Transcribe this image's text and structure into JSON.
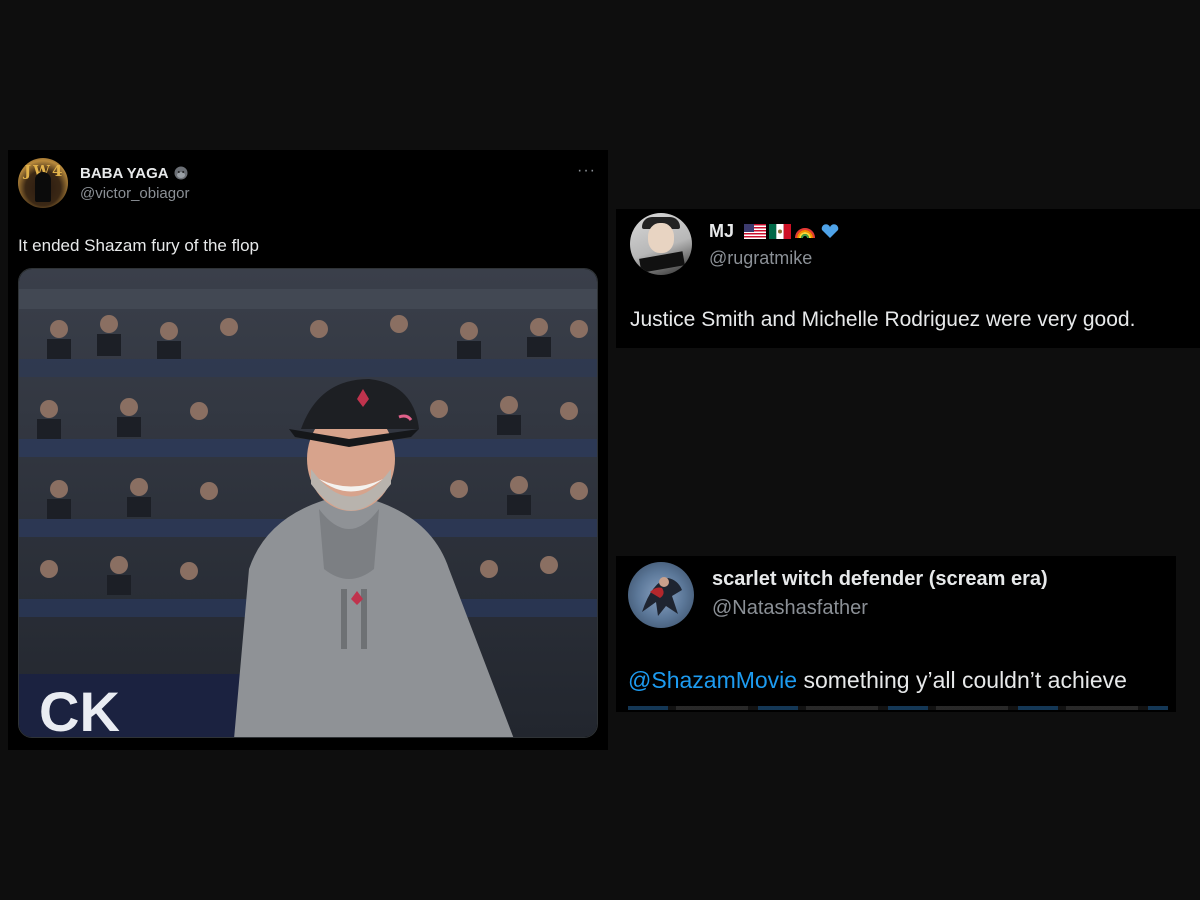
{
  "tweets": [
    {
      "display_name": "BABA YAGA",
      "badge_icon": "gorilla-emoji-icon",
      "handle": "@victor_obiagor",
      "more_label": "···",
      "text": "It ended Shazam fury of the flop",
      "media_description_icon": "photo-smiling-man-in-grey-hoodie-and-cap-stadium-crowd"
    },
    {
      "display_name": "MJ",
      "flag_icons": [
        "us-flag-icon",
        "mexico-flag-icon",
        "rainbow-icon",
        "blue-heart-icon"
      ],
      "handle": "@rugratmike",
      "text": "Justice Smith and Michelle Rodriguez were very good."
    },
    {
      "display_name": "scarlet witch defender (scream era)",
      "handle": "@Natashasfather",
      "mention": "@ShazamMovie",
      "text_rest": " something y’all couldn’t achieve"
    }
  ],
  "colors": {
    "page_bg": "#0e0e0e",
    "card_bg": "#000000",
    "text": "#e7e9ea",
    "muted": "#8b9096",
    "link": "#1d9bf0"
  }
}
